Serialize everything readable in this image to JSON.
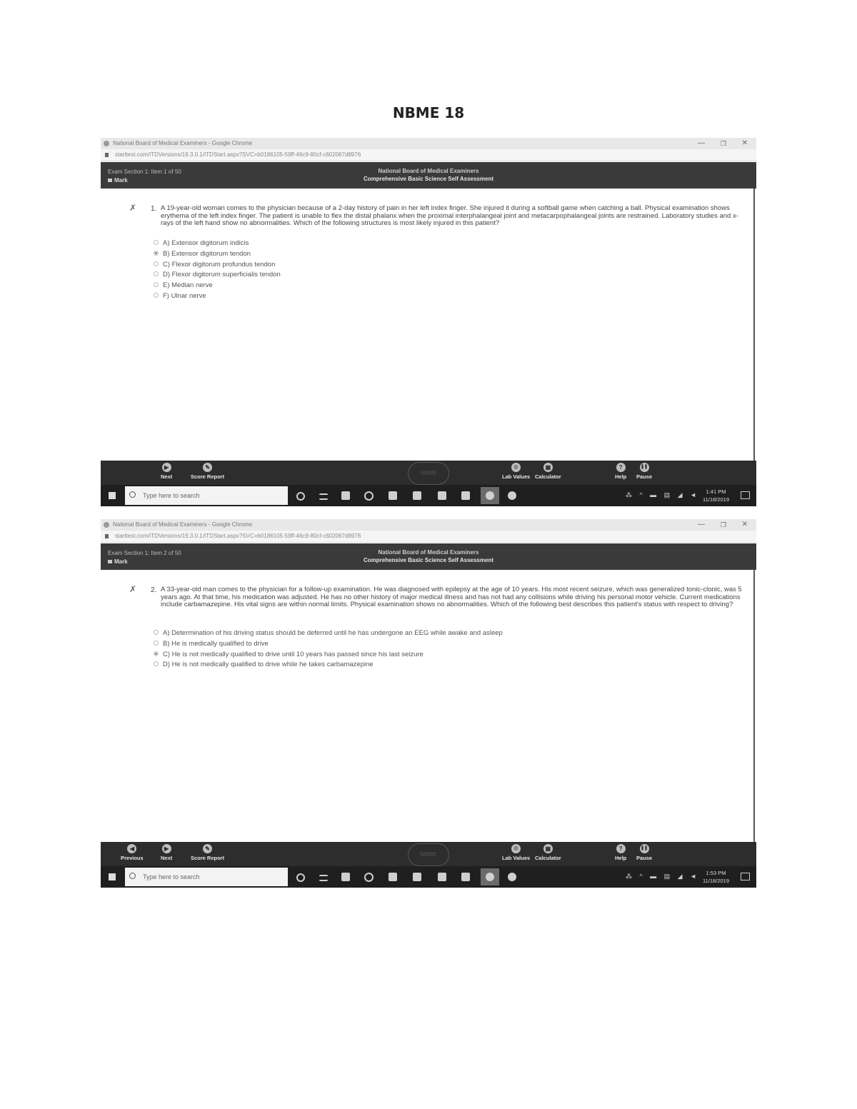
{
  "document_title": "NBME 18",
  "screenshots": [
    {
      "window_title": "National Board of Medical Examiners - Google Chrome",
      "url": "starttest.com/ITDVersions/19.3.0.1/ITDStart.aspx?SVC=b0186105-59ff-46c9-80cf-c602067d8976",
      "item_info": "Exam Section 1: Item 1 of 50",
      "mark_label": "Mark",
      "board_name": "National Board of Medical Examiners",
      "exam_name": "Comprehensive Basic Science Self Assessment",
      "question_number": "1.",
      "question_stem": "A 19-year-old woman comes to the physician because of a 2-day history of pain in her left index finger. She injured it during a softball game when catching a ball. Physical examination shows erythema of the left index finger. The patient is unable to flex the distal phalanx when the proximal interphalangeal joint and metacarpophalangeal joints are restrained. Laboratory studies and x-rays of the left hand show no abnormalities. Which of the following structures is most likely injured in this patient?",
      "options": [
        {
          "letter": "A)",
          "text": "Extensor digitorum indicis",
          "selected": false
        },
        {
          "letter": "B)",
          "text": "Extensor digitorum tendon",
          "selected": true
        },
        {
          "letter": "C)",
          "text": "Flexor digitorum profundus tendon",
          "selected": false
        },
        {
          "letter": "D)",
          "text": "Flexor digitorum superficialis tendon",
          "selected": false
        },
        {
          "letter": "E)",
          "text": "Median nerve",
          "selected": false
        },
        {
          "letter": "F)",
          "text": "Ulnar nerve",
          "selected": false
        }
      ],
      "footer": {
        "next": "Next",
        "score_report": "Score Report",
        "lab_values": "Lab Values",
        "calculator": "Calculator",
        "help": "Help",
        "pause": "Pause"
      },
      "taskbar": {
        "search_placeholder": "Type here to search",
        "time": "1:41 PM",
        "date": "11/18/2019"
      }
    },
    {
      "window_title": "National Board of Medical Examiners - Google Chrome",
      "url": "starttest.com/ITDVersions/19.3.0.1/ITDStart.aspx?SVC=b0186105-59ff-46c9-80cf-c602067d8976",
      "item_info": "Exam Section 1: Item 2 of 50",
      "mark_label": "Mark",
      "board_name": "National Board of Medical Examiners",
      "exam_name": "Comprehensive Basic Science Self Assessment",
      "question_number": "2.",
      "question_stem": "A 33-year-old man comes to the physician for a follow-up examination. He was diagnosed with epilepsy at the age of 10 years. His most recent seizure, which was generalized tonic-clonic, was 5 years ago. At that time, his medication was adjusted. He has no other history of major medical illness and has not had any collisions while driving his personal motor vehicle. Current medications include carbamazepine. His vital signs are within normal limits. Physical examination shows no abnormalities. Which of the following best describes this patient's status with respect to driving?",
      "options": [
        {
          "letter": "A)",
          "text": "Determination of his driving status should be deferred until he has undergone an EEG while awake and asleep",
          "selected": false
        },
        {
          "letter": "B)",
          "text": "He is medically qualified to drive",
          "selected": false
        },
        {
          "letter": "C)",
          "text": "He is not medically qualified to drive until 10 years has passed since his last seizure",
          "selected": true
        },
        {
          "letter": "D)",
          "text": "He is not medically qualified to drive while he takes carbamazepine",
          "selected": false
        }
      ],
      "footer": {
        "previous": "Previous",
        "next": "Next",
        "score_report": "Score Report",
        "lab_values": "Lab Values",
        "calculator": "Calculator",
        "help": "Help",
        "pause": "Pause"
      },
      "taskbar": {
        "search_placeholder": "Type here to search",
        "time": "1:53 PM",
        "date": "11/18/2019"
      }
    }
  ]
}
